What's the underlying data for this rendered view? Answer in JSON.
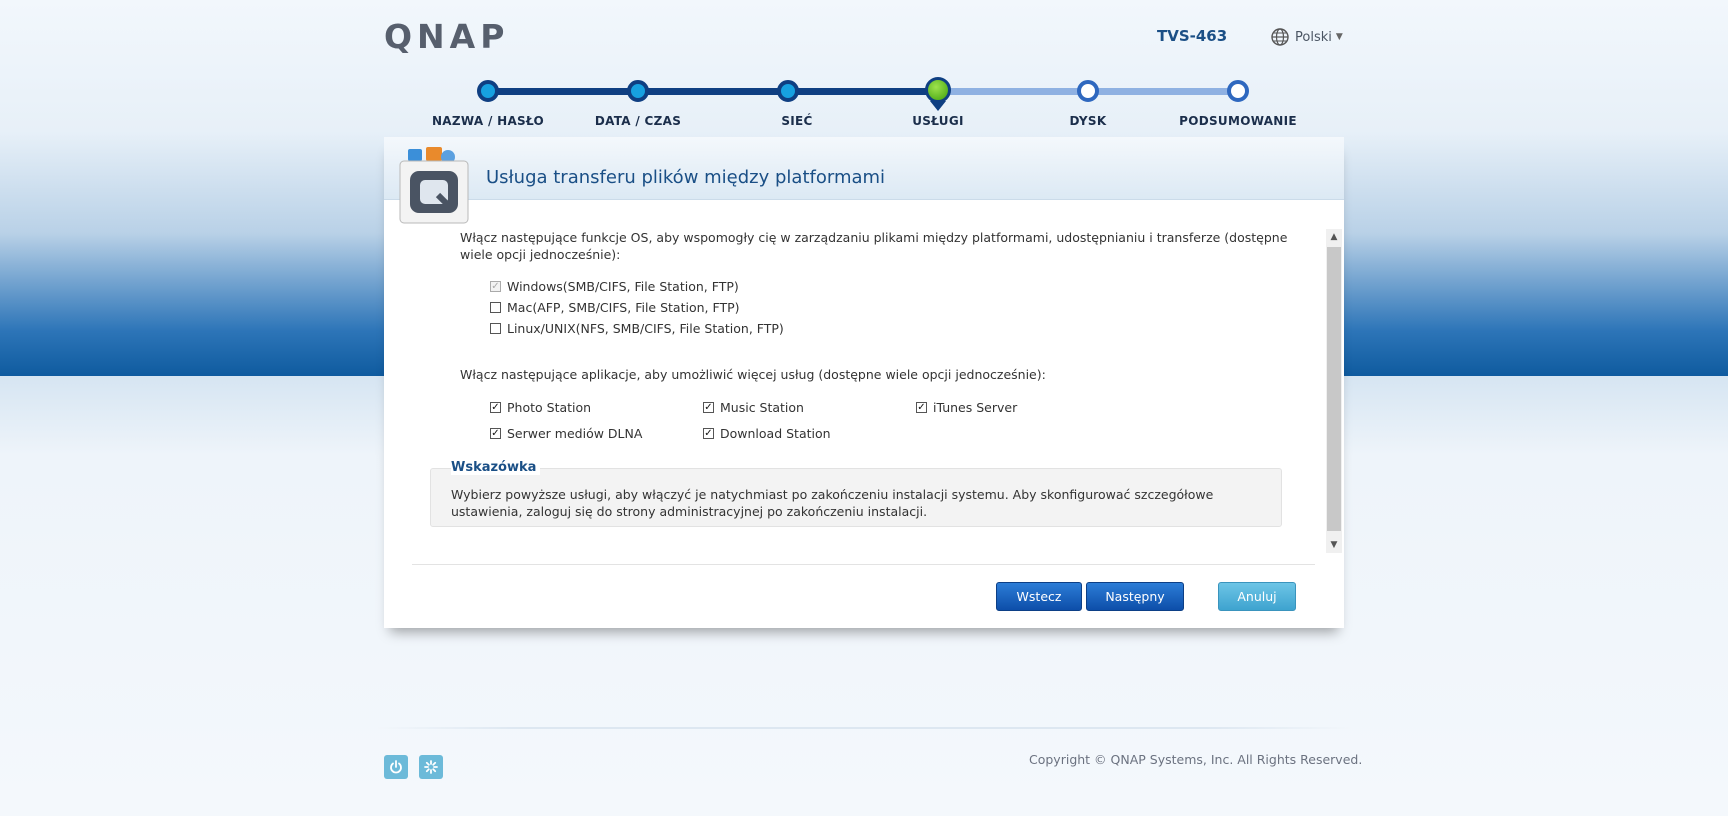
{
  "header": {
    "logo_text": "QNAP",
    "model": "TVS-463",
    "language": "Polski"
  },
  "steps": [
    {
      "label": "NAZWA / HASŁO",
      "state": "done"
    },
    {
      "label": "DATA / CZAS",
      "state": "done"
    },
    {
      "label": "SIEĆ",
      "state": "done"
    },
    {
      "label": "USŁUGI",
      "state": "current"
    },
    {
      "label": "DYSK",
      "state": "todo"
    },
    {
      "label": "PODSUMOWANIE",
      "state": "todo"
    }
  ],
  "dialog": {
    "title": "Usługa transferu plików między platformami",
    "os_intro": "Włącz następujące funkcje OS, aby wspomogły cię w zarządzaniu plikami między platformami, udostępnianiu i transferze (dostępne wiele opcji jednocześnie):",
    "os_options": [
      {
        "label": "Windows(SMB/CIFS, File Station, FTP)",
        "checked": true,
        "disabled": true
      },
      {
        "label": "Mac(AFP, SMB/CIFS, File Station, FTP)",
        "checked": false,
        "disabled": false
      },
      {
        "label": "Linux/UNIX(NFS, SMB/CIFS, File Station, FTP)",
        "checked": false,
        "disabled": false
      }
    ],
    "apps_intro": "Włącz następujące aplikacje, aby umożliwić więcej usług (dostępne wiele opcji jednocześnie):",
    "apps": [
      {
        "label": "Photo Station",
        "checked": true
      },
      {
        "label": "Music Station",
        "checked": true
      },
      {
        "label": "iTunes Server",
        "checked": true
      },
      {
        "label": "Serwer mediów DLNA",
        "checked": true
      },
      {
        "label": "Download Station",
        "checked": true
      }
    ],
    "hint_title": "Wskazówka",
    "hint_text": "Wybierz powyższe usługi, aby włączyć je natychmiast po zakończeniu instalacji systemu. Aby skonfigurować szczegółowe ustawienia, zaloguj się do strony administracyjnej po zakończeniu instalacji.",
    "buttons": {
      "back": "Wstecz",
      "next": "Następny",
      "cancel": "Anuluj"
    }
  },
  "footer": {
    "copyright": "Copyright © QNAP Systems, Inc. All Rights Reserved."
  },
  "colors": {
    "primary_button": "#0d4ea9",
    "cancel_button": "#3ea3cf",
    "title": "#1a4f86",
    "step_done": "#17a1e0",
    "step_current": "#3ea10d"
  }
}
